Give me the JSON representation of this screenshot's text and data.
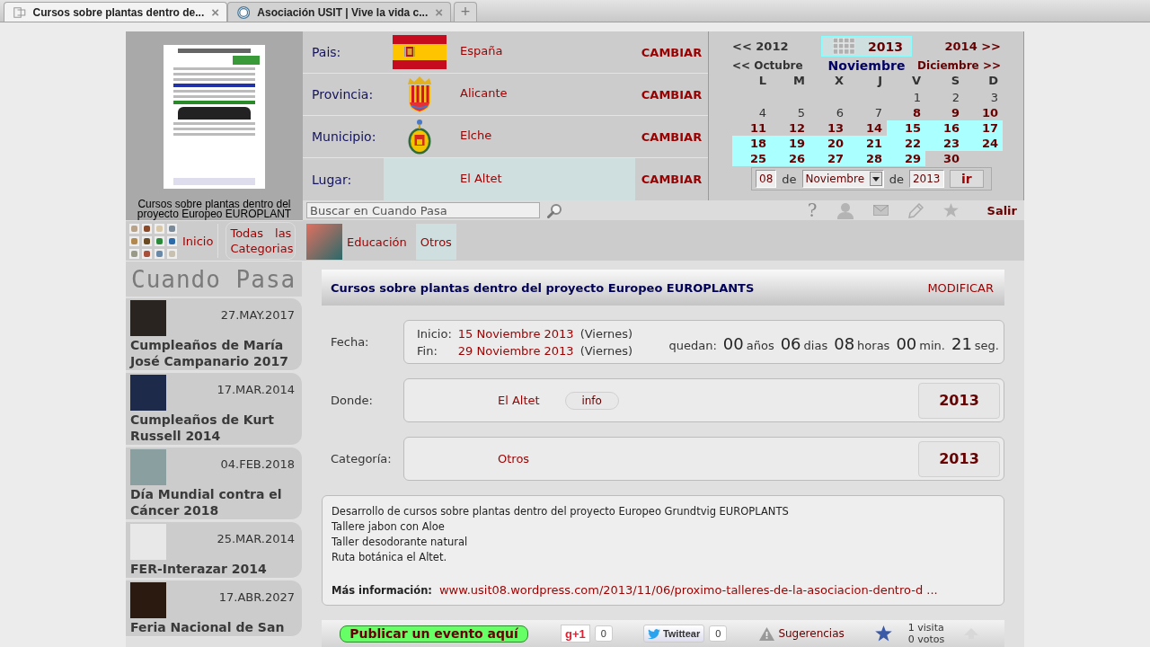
{
  "browser": {
    "tabs": [
      {
        "title": "Cursos sobre plantas dentro de...",
        "close": "×",
        "selected": true
      },
      {
        "title": "Asociación USIT | Vive la vida c...",
        "close": "×",
        "selected": false
      }
    ],
    "new_tab": "+"
  },
  "poster": {
    "caption": "Cursos sobre plantas dentro del proyecto Europeo EUROPLANT"
  },
  "location": [
    {
      "label": "Pais:",
      "value": "España",
      "action": "CAMBIAR",
      "selected": false
    },
    {
      "label": "Provincia:",
      "value": "Alicante",
      "action": "CAMBIAR",
      "selected": false
    },
    {
      "label": "Municipio:",
      "value": "Elche",
      "action": "CAMBIAR",
      "selected": false
    },
    {
      "label": "Lugar:",
      "value": "El Altet",
      "action": "CAMBIAR",
      "selected": true
    }
  ],
  "calendar": {
    "prev_year": "<< 2012",
    "year": "2013",
    "next_year": "2014 >>",
    "prev_month": "<< Octubre",
    "month": "Noviembre",
    "next_month": "Diciembre >>",
    "weekdays": [
      "L",
      "M",
      "X",
      "J",
      "V",
      "S",
      "D"
    ],
    "weeks": [
      [
        {
          "day": "1",
          "event": false,
          "in_range": false
        },
        {
          "day": "2",
          "event": false,
          "in_range": false
        },
        {
          "day": "3",
          "event": false,
          "in_range": false
        }
      ],
      [
        {
          "day": "4",
          "event": false,
          "in_range": false
        },
        {
          "day": "5",
          "event": false,
          "in_range": false
        },
        {
          "day": "6",
          "event": false,
          "in_range": false
        },
        {
          "day": "7",
          "event": false,
          "in_range": false
        },
        {
          "day": "8",
          "event": true,
          "in_range": false
        },
        {
          "day": "9",
          "event": true,
          "in_range": false
        },
        {
          "day": "10",
          "event": true,
          "in_range": false
        }
      ],
      [
        {
          "day": "11",
          "event": true,
          "in_range": false
        },
        {
          "day": "12",
          "event": true,
          "in_range": false
        },
        {
          "day": "13",
          "event": true,
          "in_range": false
        },
        {
          "day": "14",
          "event": true,
          "in_range": false
        },
        {
          "day": "15",
          "event": true,
          "in_range": true
        },
        {
          "day": "16",
          "event": true,
          "in_range": true
        },
        {
          "day": "17",
          "event": true,
          "in_range": true
        }
      ],
      [
        {
          "day": "18",
          "event": true,
          "in_range": true
        },
        {
          "day": "19",
          "event": true,
          "in_range": true
        },
        {
          "day": "20",
          "event": true,
          "in_range": true
        },
        {
          "day": "21",
          "event": true,
          "in_range": true
        },
        {
          "day": "22",
          "event": true,
          "in_range": true
        },
        {
          "day": "23",
          "event": true,
          "in_range": true
        },
        {
          "day": "24",
          "event": true,
          "in_range": true
        }
      ],
      [
        {
          "day": "25",
          "event": true,
          "in_range": true
        },
        {
          "day": "26",
          "event": true,
          "in_range": true
        },
        {
          "day": "27",
          "event": true,
          "in_range": true
        },
        {
          "day": "28",
          "event": true,
          "in_range": true
        },
        {
          "day": "29",
          "event": true,
          "in_range": true
        },
        {
          "day": "30",
          "event": true,
          "in_range": false
        }
      ]
    ],
    "goto": {
      "day": "08",
      "joiner_1": "de",
      "month": "Noviembre",
      "joiner_2": "de",
      "year": "2013",
      "button": "ir"
    }
  },
  "toolbar": {
    "search_placeholder": "Buscar en Cuando Pasa",
    "help": "?",
    "logout": "Salir"
  },
  "categories": {
    "home": "Inicio",
    "all": "Todas las Categorias",
    "items": [
      {
        "label": "Educación",
        "kind": "image",
        "selected": false
      },
      {
        "label": "Otros",
        "kind": "text",
        "selected": true
      }
    ]
  },
  "sidebar": {
    "title": "Cuando Pasa",
    "events": [
      {
        "date": "27.MAY.2017",
        "title": "Cumpleaños de María José Campanario 2017"
      },
      {
        "date": "17.MAR.2014",
        "title": "Cumpleaños de Kurt Russell 2014"
      },
      {
        "date": "04.FEB.2018",
        "title": "Día Mundial contra el Cáncer 2018"
      },
      {
        "date": "25.MAR.2014",
        "title": "FER-Interazar 2014"
      },
      {
        "date": "17.ABR.2027",
        "title": "Feria Nacional de San"
      }
    ]
  },
  "event": {
    "title": "Cursos sobre plantas dentro del proyecto Europeo EUROPLANTS",
    "edit": "MODIFICAR",
    "date": {
      "label": "Fecha:",
      "start_label": "Inicio:",
      "start": "15 Noviembre 2013",
      "start_day": "(Viernes)",
      "end_label": "Fin:",
      "end": "29 Noviembre 2013",
      "end_day": "(Viernes)",
      "remaining_label": "quedan:",
      "countdown": [
        {
          "value": "00",
          "unit": "años"
        },
        {
          "value": "06",
          "unit": "dias"
        },
        {
          "value": "08",
          "unit": "horas"
        },
        {
          "value": "00",
          "unit": "min."
        },
        {
          "value": "21",
          "unit": "seg."
        }
      ]
    },
    "place": {
      "label": "Donde:",
      "value": "El Altet",
      "info": "info",
      "year": "2013"
    },
    "category": {
      "label": "Categoría:",
      "value": "Otros",
      "year": "2013"
    },
    "description": {
      "lines": [
        "Desarrollo de cursos sobre plantas dentro del proyecto Europeo Grundtvig EUROPLANTS",
        "Tallere jabon con Aloe",
        "Taller desodorante natural",
        "Ruta botánica el Altet."
      ],
      "more_label": "Más información:",
      "link": "www.usit08.wordpress.com/2013/11/06/proximo-talleres-de-la-asociacion-dentro-d ..."
    }
  },
  "footer_bar": {
    "publish": "Publicar un evento aquí",
    "gplus": {
      "label": "g+1",
      "count": "0"
    },
    "tweet": {
      "label": "Twittear",
      "count": "0"
    },
    "suggest": "Sugerencias",
    "visits": "1 visita",
    "votes": "0 votos"
  }
}
